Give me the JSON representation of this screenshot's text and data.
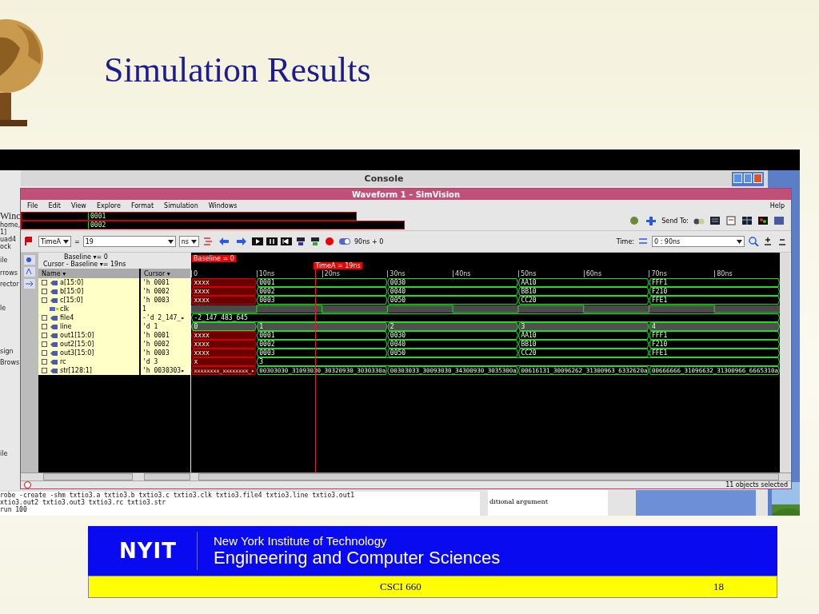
{
  "slide": {
    "title": "Simulation Results"
  },
  "desktop": {
    "left_texts": [
      "Winc",
      "home,",
      "1]",
      "uad4",
      "ock",
      "ile",
      "rrows",
      "rector",
      "le",
      "sign",
      "Brows",
      "ile"
    ],
    "console": {
      "title": "Console",
      "log_lines": [
        "robe -create -shm txtio3.a txtio3.b txtio3.c txtio3.clk txtio3.file4 txtio3.line txtio3.out1",
        "xtio3.out2 txtio3.out3 txtio3.rc txtio3.str",
        "run 100"
      ],
      "side_text": "ditional argument"
    }
  },
  "simvision": {
    "title": "Waveform 1 – SimVision",
    "menu": [
      "File",
      "Edit",
      "View",
      "Explore",
      "Format",
      "Simulation",
      "Windows"
    ],
    "help": "Help",
    "overlay_values": [
      "0001",
      "0002"
    ],
    "toolbar": {
      "send_to": "Send To:",
      "marker": "TimeA",
      "equals": "=",
      "time_value": "19",
      "unit": "ns",
      "sim_time": "90ns + 0",
      "time_label": "Time:",
      "time_range": "0 : 90ns"
    },
    "cursor_info": {
      "baseline": "Baseline ▾= 0",
      "cursor": "Cursor - Baseline ▾= 19ns"
    },
    "columns": [
      "Name ▾",
      "Cursor ▾"
    ],
    "baseline_tag": "Baseline = 0",
    "cursor_tag": "TimeA = 19ns",
    "time_ticks": [
      "0",
      "10ns",
      "20ns",
      "30ns",
      "40ns",
      "50ns",
      "60ns",
      "70ns",
      "80ns"
    ],
    "signals": [
      {
        "name": "a[15:0]",
        "cursor": "'h 0001",
        "expandable": true,
        "kind": "bus",
        "segments": [
          {
            "value": "xxxx",
            "unknown": true
          },
          {
            "value": "0001",
            "unknown": false
          },
          {
            "value": "0030",
            "unknown": false
          },
          {
            "value": "AA10",
            "unknown": false
          },
          {
            "value": "FFF1",
            "unknown": false
          }
        ]
      },
      {
        "name": "b[15:0]",
        "cursor": "'h 0002",
        "expandable": true,
        "kind": "bus",
        "segments": [
          {
            "value": "xxxx",
            "unknown": true
          },
          {
            "value": "0002",
            "unknown": false
          },
          {
            "value": "0040",
            "unknown": false
          },
          {
            "value": "BB10",
            "unknown": false
          },
          {
            "value": "F210",
            "unknown": false
          }
        ]
      },
      {
        "name": "c[15:0]",
        "cursor": "'h 0003",
        "expandable": true,
        "kind": "bus",
        "segments": [
          {
            "value": "xxxx",
            "unknown": true
          },
          {
            "value": "0003",
            "unknown": false
          },
          {
            "value": "0050",
            "unknown": false
          },
          {
            "value": "CC20",
            "unknown": false
          },
          {
            "value": "FFE1",
            "unknown": false
          }
        ]
      },
      {
        "name": "clk",
        "cursor": "1",
        "expandable": false,
        "kind": "clock"
      },
      {
        "name": "file4",
        "cursor": "-'d 2_147_▸",
        "expandable": true,
        "kind": "bus",
        "segments": [
          {
            "value": "-2_147_483_645",
            "unknown": false
          }
        ]
      },
      {
        "name": "line",
        "cursor": "'d 1",
        "expandable": true,
        "kind": "integer",
        "segments": [
          {
            "value": "0",
            "unknown": false
          },
          {
            "value": "1",
            "unknown": false
          },
          {
            "value": "2",
            "unknown": false
          },
          {
            "value": "3",
            "unknown": false
          },
          {
            "value": "4",
            "unknown": false
          }
        ]
      },
      {
        "name": "out1[15:0]",
        "cursor": "'h 0001",
        "expandable": true,
        "kind": "bus",
        "segments": [
          {
            "value": "xxxx",
            "unknown": true
          },
          {
            "value": "0001",
            "unknown": false
          },
          {
            "value": "0030",
            "unknown": false
          },
          {
            "value": "AA10",
            "unknown": false
          },
          {
            "value": "FFF1",
            "unknown": false
          }
        ]
      },
      {
        "name": "out2[15:0]",
        "cursor": "'h 0002",
        "expandable": true,
        "kind": "bus",
        "segments": [
          {
            "value": "xxxx",
            "unknown": true
          },
          {
            "value": "0002",
            "unknown": false
          },
          {
            "value": "0040",
            "unknown": false
          },
          {
            "value": "BB10",
            "unknown": false
          },
          {
            "value": "F210",
            "unknown": false
          }
        ]
      },
      {
        "name": "out3[15:0]",
        "cursor": "'h 0003",
        "expandable": true,
        "kind": "bus",
        "segments": [
          {
            "value": "xxxx",
            "unknown": true
          },
          {
            "value": "0003",
            "unknown": false
          },
          {
            "value": "0050",
            "unknown": false
          },
          {
            "value": "CC20",
            "unknown": false
          },
          {
            "value": "FFE1",
            "unknown": false
          }
        ]
      },
      {
        "name": "rc",
        "cursor": "'d 3",
        "expandable": true,
        "kind": "bus",
        "segments": [
          {
            "value": "x",
            "unknown": true
          },
          {
            "value": "3",
            "unknown": false
          }
        ]
      },
      {
        "name": "str[128:1]",
        "cursor": "'h 0030303▸",
        "expandable": true,
        "kind": "bus",
        "segments": [
          {
            "value": "xxxxxxxx_xxxxxxxx_▸",
            "unknown": true
          },
          {
            "value": "00303030_31093030_30320930_3030330a",
            "unknown": false
          },
          {
            "value": "00303033_30093030_34300930_3035300a",
            "unknown": false
          },
          {
            "value": "00616131_30096262_31300963_6332620a",
            "unknown": false
          },
          {
            "value": "00666666_31096632_31300966_6665310a",
            "unknown": false
          }
        ]
      }
    ],
    "status": "11 objects selected"
  },
  "footer": {
    "logo": "NYIT",
    "institute": "New York Institute of Technology",
    "department": "Engineering and Computer Sciences",
    "course": "CSCI 660",
    "page": "18"
  }
}
